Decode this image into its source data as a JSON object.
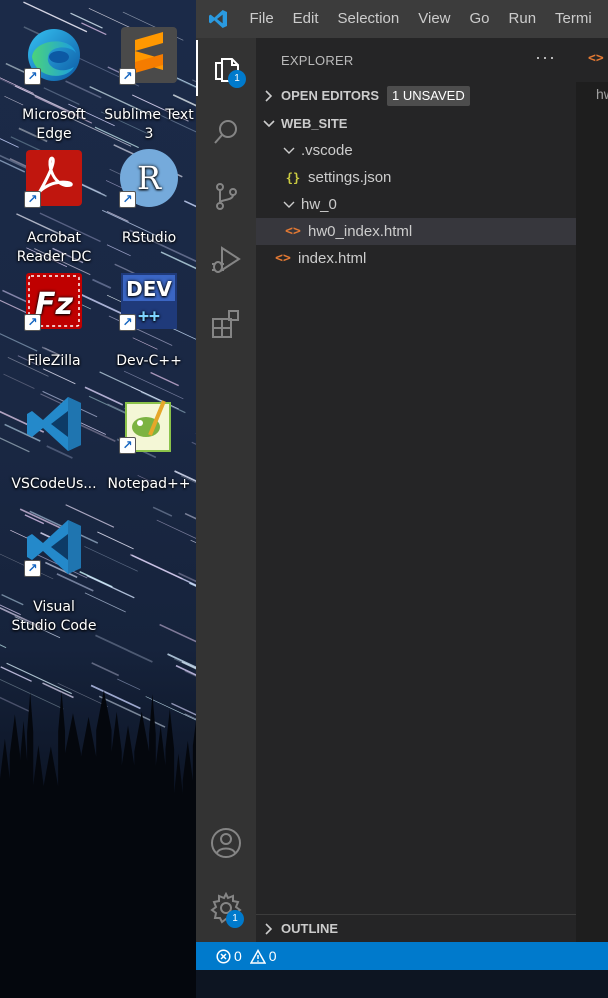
{
  "desktop": {
    "icons": [
      {
        "label": "Microsoft\nEdge",
        "icon": "edge-icon"
      },
      {
        "label": "Sublime Text\n3",
        "icon": "sublime-icon"
      },
      {
        "label": "Acrobat\nReader DC",
        "icon": "acrobat-icon"
      },
      {
        "label": "RStudio",
        "icon": "rstudio-icon"
      },
      {
        "label": "FileZilla",
        "icon": "filezilla-icon"
      },
      {
        "label": "Dev-C++",
        "icon": "devcpp-icon"
      },
      {
        "label": "VSCodeUs...",
        "icon": "vscode-icon"
      },
      {
        "label": "Notepad++",
        "icon": "notepadpp-icon"
      },
      {
        "label": "Visual\nStudio Code",
        "icon": "vscode-icon"
      }
    ]
  },
  "vscode": {
    "menu": [
      "File",
      "Edit",
      "Selection",
      "View",
      "Go",
      "Run",
      "Termi"
    ],
    "activity": {
      "explorer_badge": "1",
      "settings_badge": "1"
    },
    "sidebar": {
      "title": "EXPLORER",
      "more": "···",
      "open_editors": "OPEN EDITORS",
      "unsaved": "1 UNSAVED",
      "workspace": "WEB_SITE",
      "tree": [
        {
          "label": ".vscode",
          "type": "folder"
        },
        {
          "label": "settings.json",
          "type": "json",
          "icon_glyph": "{}"
        },
        {
          "label": "hw_0",
          "type": "folder"
        },
        {
          "label": "hw0_index.html",
          "type": "html",
          "icon_glyph": "<>"
        },
        {
          "label": "index.html",
          "type": "html",
          "icon_glyph": "<>"
        }
      ],
      "outline": "OUTLINE"
    },
    "editor": {
      "tab_icon": "<>",
      "breadcrumb": "hw"
    },
    "status": {
      "errors": "0",
      "warnings": "0"
    },
    "colors": {
      "accent": "#007acc",
      "json_icon": "#cbcb41",
      "html_icon": "#e37933"
    }
  }
}
